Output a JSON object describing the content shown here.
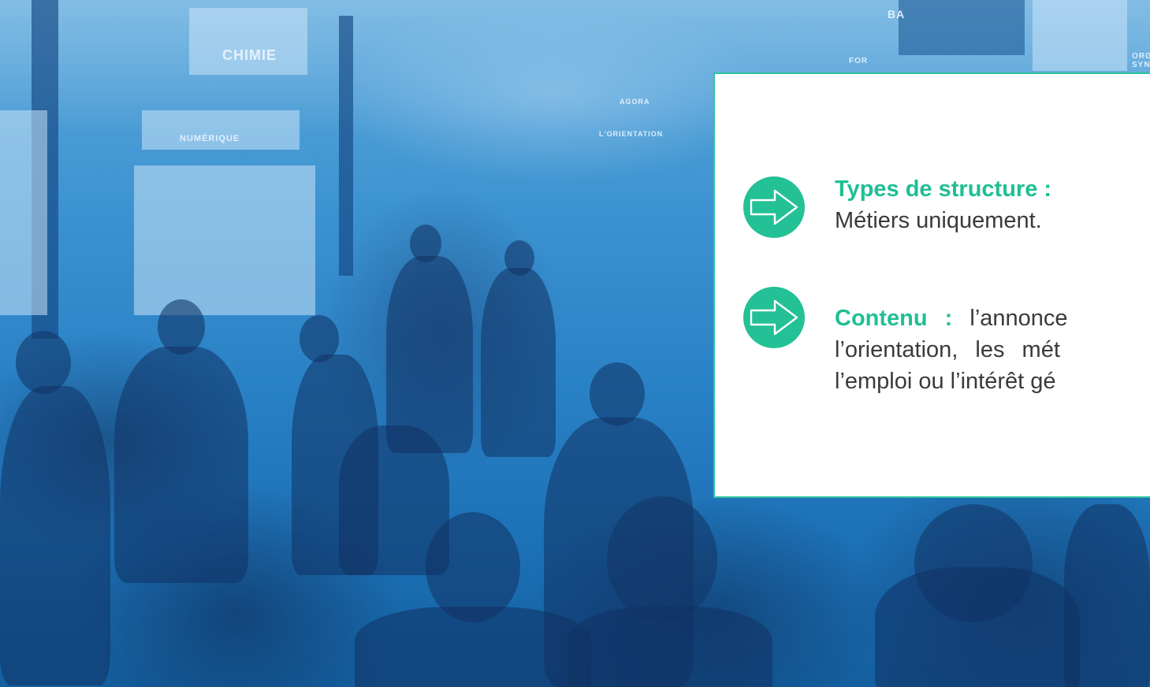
{
  "background": {
    "signs": [
      "CHIMIE",
      "AGORA",
      "NUMÉRIQUE",
      "L'ORIENTATION",
      "BA",
      "FOR",
      "ORG SYN"
    ]
  },
  "card": {
    "items": [
      {
        "icon": "arrow-right-circle-icon",
        "label": "Types de structure :",
        "line1": "Métiers uniquement."
      },
      {
        "icon": "arrow-right-circle-icon",
        "label": "Contenu :",
        "line1_rest": "l’annonce",
        "line2": "l’orientation, les mét",
        "line3": "l’emploi ou l’intérêt gé"
      }
    ]
  },
  "colors": {
    "accent": "#23c195",
    "accent_text": "#1fbf94",
    "card_border": "#2dc5a0",
    "overlay_blue": "#1f7fc4"
  }
}
